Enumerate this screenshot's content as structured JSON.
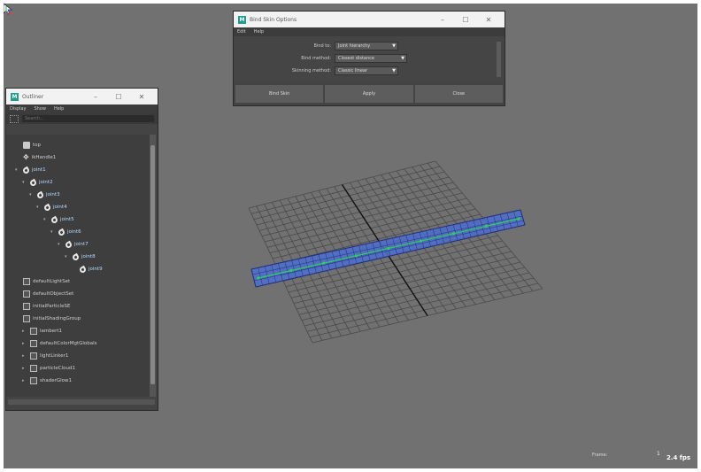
{
  "bindskin": {
    "title": "Bind Skin Options",
    "menu": [
      "Edit",
      "Help"
    ],
    "options": [
      {
        "label": "Bind to:",
        "value": "Joint hierarchy"
      },
      {
        "label": "Bind method:",
        "value": "Closest distance"
      },
      {
        "label": "Skinning method:",
        "value": "Classic linear"
      }
    ],
    "buttons": {
      "bind": "Bind Skin",
      "apply": "Apply",
      "close": "Close"
    }
  },
  "outliner": {
    "title": "Outliner",
    "menu": [
      "Display",
      "Show",
      "Help"
    ],
    "search_placeholder": "Search...",
    "rows": [
      {
        "label": "top",
        "icon": "camera-icon",
        "indent": 0,
        "expand": ""
      },
      {
        "label": "ikHandle1",
        "icon": "locator-icon",
        "indent": 0,
        "expand": ""
      },
      {
        "label": "joint1",
        "icon": "joint-icon",
        "indent": 0,
        "expand": "▾"
      },
      {
        "label": "joint2",
        "icon": "joint-icon",
        "indent": 1,
        "expand": "▾"
      },
      {
        "label": "joint3",
        "icon": "joint-icon",
        "indent": 2,
        "expand": "▾"
      },
      {
        "label": "joint4",
        "icon": "joint-icon",
        "indent": 3,
        "expand": "▾"
      },
      {
        "label": "joint5",
        "icon": "joint-icon",
        "indent": 4,
        "expand": "▾"
      },
      {
        "label": "joint6",
        "icon": "joint-icon",
        "indent": 5,
        "expand": "▾"
      },
      {
        "label": "joint7",
        "icon": "joint-icon",
        "indent": 6,
        "expand": "▾"
      },
      {
        "label": "joint8",
        "icon": "joint-icon",
        "indent": 7,
        "expand": "▾"
      },
      {
        "label": "joint9",
        "icon": "joint-icon",
        "indent": 8,
        "expand": ""
      },
      {
        "label": "defaultLightSet",
        "icon": "set-icon",
        "indent": 0,
        "expand": ""
      },
      {
        "label": "defaultObjectSet",
        "icon": "set-icon",
        "indent": 0,
        "expand": ""
      },
      {
        "label": "initialParticleSE",
        "icon": "set-icon",
        "indent": 0,
        "expand": ""
      },
      {
        "label": "initialShadingGroup",
        "icon": "set-icon",
        "indent": 0,
        "expand": ""
      },
      {
        "label": "lambert1",
        "icon": "shader-icon",
        "indent": 1,
        "expand": "▸"
      },
      {
        "label": "defaultColorMgtGlobals",
        "icon": "shader-icon",
        "indent": 1,
        "expand": "▸"
      },
      {
        "label": "lightLinker1",
        "icon": "shader-icon",
        "indent": 1,
        "expand": "▸"
      },
      {
        "label": "particleCloud1",
        "icon": "shader-icon",
        "indent": 1,
        "expand": "▸"
      },
      {
        "label": "shaderGlow1",
        "icon": "shader-icon",
        "indent": 1,
        "expand": "▸"
      }
    ]
  },
  "viewport": {
    "fps": "2.4 fps",
    "hud_label": "Frame:",
    "hud_value": "1"
  },
  "colors": {
    "viewport_bg": "#717171",
    "grid_line": "#4a4a4a",
    "axis_line": "#111111",
    "mesh_fill": "#4c6fd0",
    "mesh_wire": "#1f2f7a",
    "joint_chain": "#2fcf5a"
  }
}
